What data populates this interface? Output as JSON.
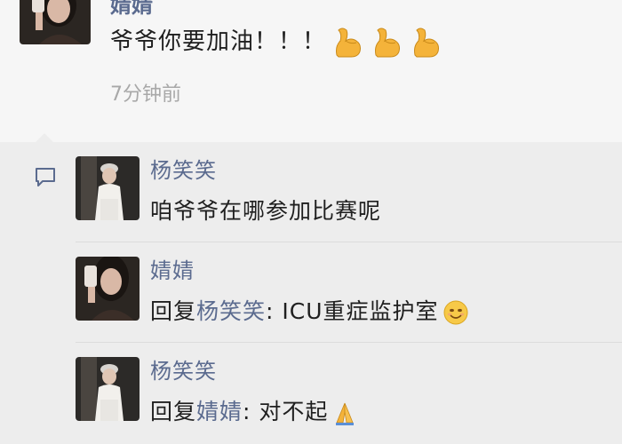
{
  "post": {
    "author": "婧婧",
    "text": "爷爷你要加油！！！",
    "emoji_count": 3,
    "emoji_icon": "flexed-biceps-icon",
    "time": "7分钟前"
  },
  "comments": [
    {
      "author": "杨笑笑",
      "reply_prefix": "",
      "reply_to": "",
      "separator": "",
      "text": "咱爷爷在哪参加比赛呢",
      "emoji_icon": ""
    },
    {
      "author": "婧婧",
      "reply_prefix": "回复",
      "reply_to": "杨笑笑",
      "separator": ": ",
      "text": "ICU重症监护室",
      "emoji_icon": "smiling-face-icon"
    },
    {
      "author": "杨笑笑",
      "reply_prefix": "回复",
      "reply_to": "婧婧",
      "separator": ": ",
      "text": "对不起",
      "emoji_icon": "folded-hands-icon"
    }
  ],
  "colors": {
    "name": "#5b6b8f",
    "text": "#1f1f1f",
    "time": "#a8a8a8",
    "comment_bg": "#ededed"
  }
}
